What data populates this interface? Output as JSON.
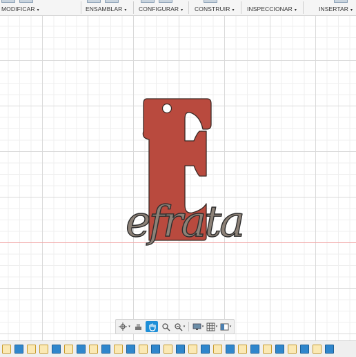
{
  "toolbar": {
    "menus": [
      {
        "label": "MODIFICAR",
        "caret": "▾"
      },
      {
        "label": "ENSAMBLAR",
        "caret": "▾"
      },
      {
        "label": "CONFIGURAR",
        "caret": "▾"
      },
      {
        "label": "CONSTRUIR",
        "caret": "▾"
      },
      {
        "label": "INSPECCIONAR",
        "caret": "▾"
      },
      {
        "label": "INSERTAR",
        "caret": "▾"
      }
    ]
  },
  "model": {
    "letter": "E",
    "script_text": "efrata",
    "letter_color": "#b94a3e",
    "script_color": "#8c8177"
  },
  "colors": {
    "grid_major": "#d9d9d9",
    "grid_minor": "#efefef",
    "axis_red": "#f2a8a8",
    "accent_blue": "#1e8fd8"
  },
  "navbar": {
    "buttons": [
      "orbit-icon",
      "look-at-icon",
      "pan-icon",
      "zoom-icon",
      "zoom-window-icon",
      "display-settings-icon",
      "grid-icon",
      "viewports-icon"
    ]
  },
  "timeline": {
    "items": [
      "sketch",
      "body",
      "sketch",
      "sketch",
      "body",
      "sketch",
      "body",
      "sketch",
      "body",
      "sketch",
      "body",
      "sketch",
      "body",
      "sketch",
      "body",
      "sketch",
      "body",
      "sketch",
      "body",
      "sketch",
      "body",
      "sketch",
      "body",
      "sketch",
      "body",
      "sketch",
      "body"
    ]
  }
}
